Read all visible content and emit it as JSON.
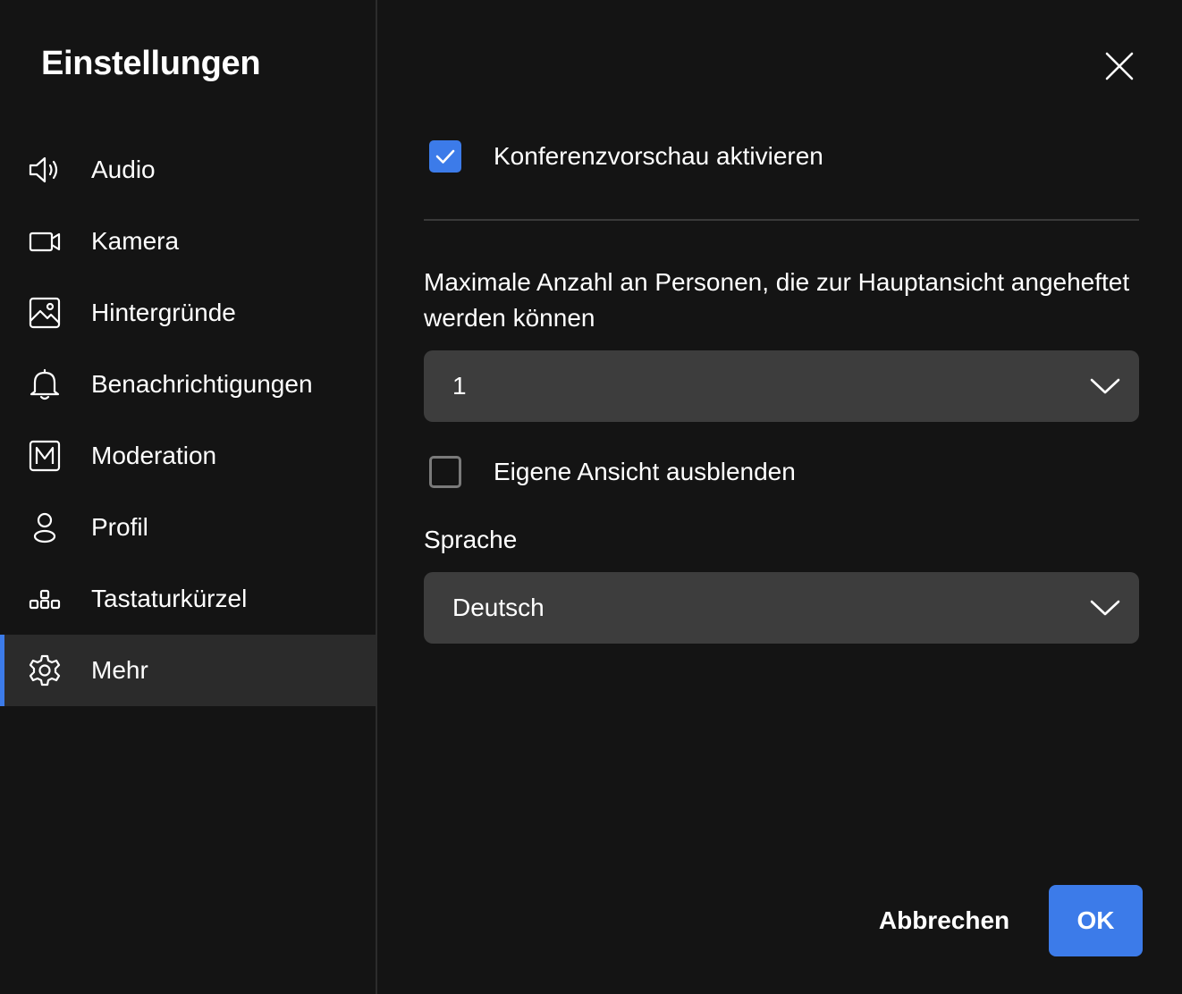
{
  "dialog": {
    "title": "Einstellungen"
  },
  "sidebar": {
    "items": [
      {
        "label": "Audio",
        "icon": "speaker-icon"
      },
      {
        "label": "Kamera",
        "icon": "camera-icon"
      },
      {
        "label": "Hintergründe",
        "icon": "image-icon"
      },
      {
        "label": "Benachrichtigungen",
        "icon": "bell-icon"
      },
      {
        "label": "Moderation",
        "icon": "moderation-icon"
      },
      {
        "label": "Profil",
        "icon": "user-icon"
      },
      {
        "label": "Tastaturkürzel",
        "icon": "keyboard-shortcuts-icon"
      },
      {
        "label": "Mehr",
        "icon": "gear-icon",
        "active": true
      }
    ]
  },
  "main": {
    "preview_checkbox": {
      "label": "Konferenzvorschau aktivieren",
      "checked": true
    },
    "max_pinned": {
      "label": "Maximale Anzahl an Personen, die zur Hauptansicht angeheftet werden können",
      "value": "1"
    },
    "hide_self_checkbox": {
      "label": "Eigene Ansicht ausblenden",
      "checked": false
    },
    "language": {
      "label": "Sprache",
      "value": "Deutsch"
    }
  },
  "footer": {
    "cancel_label": "Abbrechen",
    "ok_label": "OK"
  },
  "colors": {
    "accent": "#3c7be9",
    "background": "#141414",
    "select_bg": "#3d3d3d",
    "active_item_bg": "#2b2b2b"
  }
}
